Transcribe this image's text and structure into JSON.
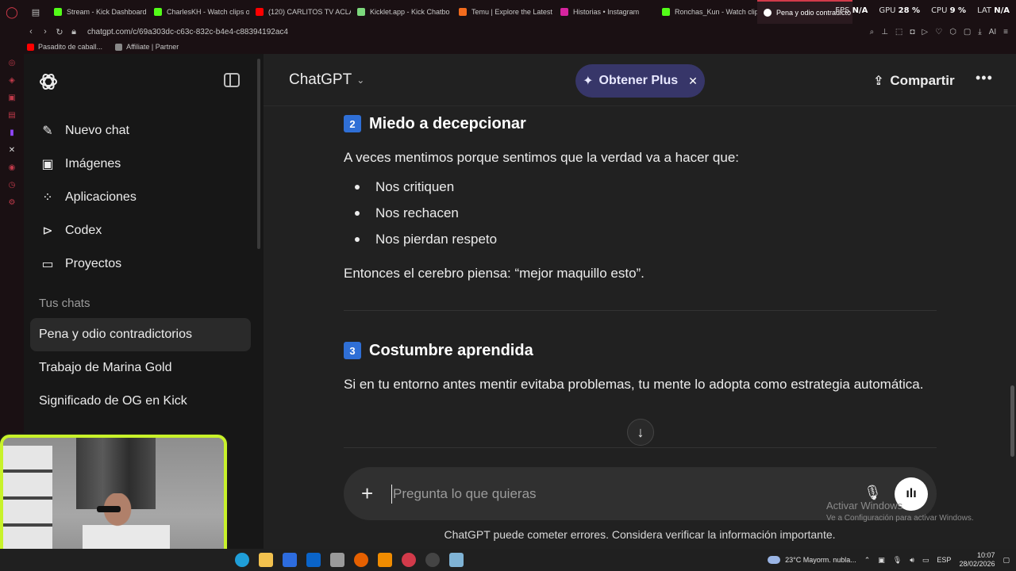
{
  "browser": {
    "tabs": [
      {
        "label": "Stream - Kick Dashboard",
        "color": "#53fc18"
      },
      {
        "label": "CharlesKH - Watch clips o",
        "color": "#53fc18"
      },
      {
        "label": "(120) CARLITOS TV ACLA",
        "color": "#ff0000"
      },
      {
        "label": "Kicklet.app - Kick Chatbo",
        "color": "#7dd87d"
      },
      {
        "label": "Temu | Explore the Latest",
        "color": "#f26b1d"
      },
      {
        "label": "Historias • Instagram",
        "color": "#d6249f"
      },
      {
        "label": "Ronchas_Kun - Watch clip",
        "color": "#53fc18"
      },
      {
        "label": "Pena y odio contradicto",
        "color": "#ffffff",
        "active": true
      }
    ],
    "hud": {
      "fps_label": "FPS",
      "fps_value": "N/A",
      "gpu_label": "GPU",
      "gpu_value": "28 %",
      "cpu_label": "CPU",
      "cpu_value": "9 %",
      "lat_label": "LAT",
      "lat_value": "N/A"
    },
    "url": "chatgpt.com/c/69a303dc-c63c-832c-b4e4-c88394192ac4",
    "bookmarks": [
      {
        "label": "Pasadito de caball...",
        "color": "#ff0000"
      },
      {
        "label": "Affiliate | Partner",
        "color": "#888888"
      }
    ],
    "ai_label": "AI"
  },
  "sidebar": {
    "nav": [
      {
        "label": "Nuevo chat",
        "icon": "edit-icon",
        "glyph": "✎"
      },
      {
        "label": "Imágenes",
        "icon": "images-icon",
        "glyph": "▣"
      },
      {
        "label": "Aplicaciones",
        "icon": "apps-icon",
        "glyph": "⁘"
      },
      {
        "label": "Codex",
        "icon": "codex-icon",
        "glyph": "⊳"
      },
      {
        "label": "Proyectos",
        "icon": "folder-icon",
        "glyph": "▭"
      }
    ],
    "section_title": "Tus chats",
    "chats": [
      {
        "label": "Pena y odio contradictorios",
        "active": true
      },
      {
        "label": "Trabajo de Marina Gold"
      },
      {
        "label": "Significado de OG en Kick"
      }
    ]
  },
  "header": {
    "model": "ChatGPT",
    "plus_label": "Obtener Plus",
    "share_label": "Compartir"
  },
  "message": {
    "section2": {
      "number": "2",
      "title": "Miedo a decepcionar"
    },
    "intro": "A veces mentimos porque sentimos que la verdad va a hacer que:",
    "bullets": [
      "Nos critiquen",
      "Nos rechacen",
      "Nos pierdan respeto"
    ],
    "conclusion": "Entonces el cerebro piensa: “mejor maquillo esto”.",
    "section3": {
      "number": "3",
      "title": "Costumbre aprendida"
    },
    "section3_text": "Si en tu entorno antes mentir evitaba problemas, tu mente lo adopta como estrategia automática."
  },
  "composer": {
    "placeholder": "Pregunta lo que quieras"
  },
  "footer_note": "ChatGPT puede cometer errores. Considera verificar la información importante.",
  "windows": {
    "activate_title": "Activar Windows",
    "activate_sub": "Ve a Configuración para activar Windows."
  },
  "taskbar": {
    "weather": "23°C  Mayorm. nubla...",
    "lang": "ESP",
    "time": "10:07",
    "date": "28/02/2026"
  },
  "colors": {
    "accent_plus": "#373669",
    "webcam_border": "#c8f22a",
    "section_badge": "#2f6fd6"
  }
}
